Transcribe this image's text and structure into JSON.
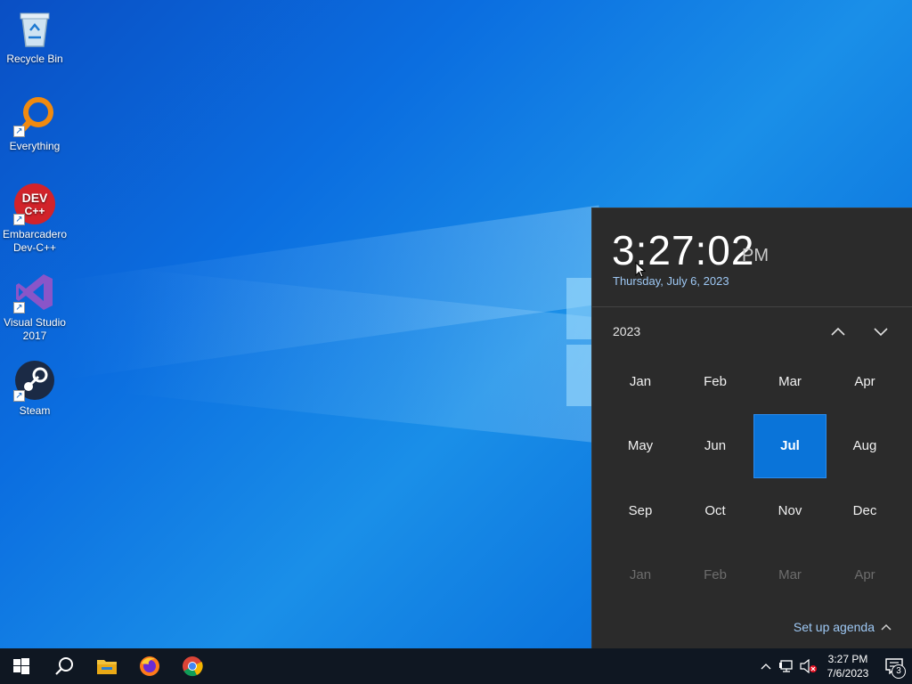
{
  "desktop": {
    "icons": [
      {
        "label": "Recycle Bin",
        "icon": "recycle-bin-icon"
      },
      {
        "label": "Everything",
        "icon": "everything-search-icon"
      },
      {
        "label": "Embarcadero Dev-C++",
        "icon": "devcpp-icon",
        "glyph_text_top": "DEV",
        "glyph_text_bottom": "C++"
      },
      {
        "label": "Visual Studio 2017",
        "icon": "visual-studio-icon"
      },
      {
        "label": "Steam",
        "icon": "steam-icon"
      }
    ]
  },
  "flyout": {
    "time": "3:27:02",
    "ampm": "PM",
    "date": "Thursday, July 6, 2023",
    "year": "2023",
    "months": [
      {
        "label": "Jan",
        "state": "normal"
      },
      {
        "label": "Feb",
        "state": "normal"
      },
      {
        "label": "Mar",
        "state": "normal"
      },
      {
        "label": "Apr",
        "state": "normal"
      },
      {
        "label": "May",
        "state": "normal"
      },
      {
        "label": "Jun",
        "state": "normal"
      },
      {
        "label": "Jul",
        "state": "selected"
      },
      {
        "label": "Aug",
        "state": "normal"
      },
      {
        "label": "Sep",
        "state": "normal"
      },
      {
        "label": "Oct",
        "state": "normal"
      },
      {
        "label": "Nov",
        "state": "normal"
      },
      {
        "label": "Dec",
        "state": "normal"
      },
      {
        "label": "Jan",
        "state": "dim"
      },
      {
        "label": "Feb",
        "state": "dim"
      },
      {
        "label": "Mar",
        "state": "dim"
      },
      {
        "label": "Apr",
        "state": "dim"
      }
    ],
    "agenda_label": "Set up agenda",
    "accent": "#0a74d9"
  },
  "taskbar": {
    "buttons": [
      "start-icon",
      "search-icon",
      "file-explorer-icon",
      "firefox-icon",
      "chrome-icon"
    ],
    "tray": {
      "time": "3:27 PM",
      "date": "7/6/2023",
      "notifications": "3"
    }
  }
}
